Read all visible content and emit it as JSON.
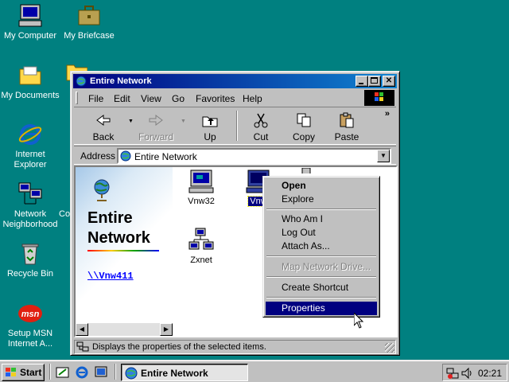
{
  "desktop": {
    "icons": [
      {
        "label": "My Computer"
      },
      {
        "label": "My Briefcase"
      },
      {
        "label": "My Documents"
      },
      {
        "label": "Internet Explorer"
      },
      {
        "label": "Network Neighborhood"
      },
      {
        "label": "Recycle Bin"
      },
      {
        "label": "Setup MSN Internet A..."
      }
    ]
  },
  "window": {
    "title": "Entire Network",
    "menu": [
      "File",
      "Edit",
      "View",
      "Go",
      "Favorites",
      "Help"
    ],
    "toolbar": {
      "back": "Back",
      "forward": "Forward",
      "up": "Up",
      "cut": "Cut",
      "copy": "Copy",
      "paste": "Paste",
      "more": "»"
    },
    "address": {
      "label": "Address",
      "value": "Entire Network"
    },
    "webview": {
      "title_line1": "Entire",
      "title_line2": "Network",
      "link": "\\\\Vnw411"
    },
    "items": [
      {
        "label": "Vnw32"
      },
      {
        "label": "Vnw"
      },
      {
        "label": "Zxnet"
      }
    ],
    "status": "Displays the properties of the selected items."
  },
  "context_menu": {
    "items": [
      "Open",
      "Explore",
      "Who Am I",
      "Log Out",
      "Attach As...",
      "Map Network Drive...",
      "Create Shortcut",
      "Properties"
    ]
  },
  "taskbar": {
    "start": "Start",
    "task": "Entire Network",
    "clock": "02:21"
  },
  "colors": {
    "desktop": "#008080",
    "titlebar": "#000080",
    "highlight": "#000080"
  }
}
